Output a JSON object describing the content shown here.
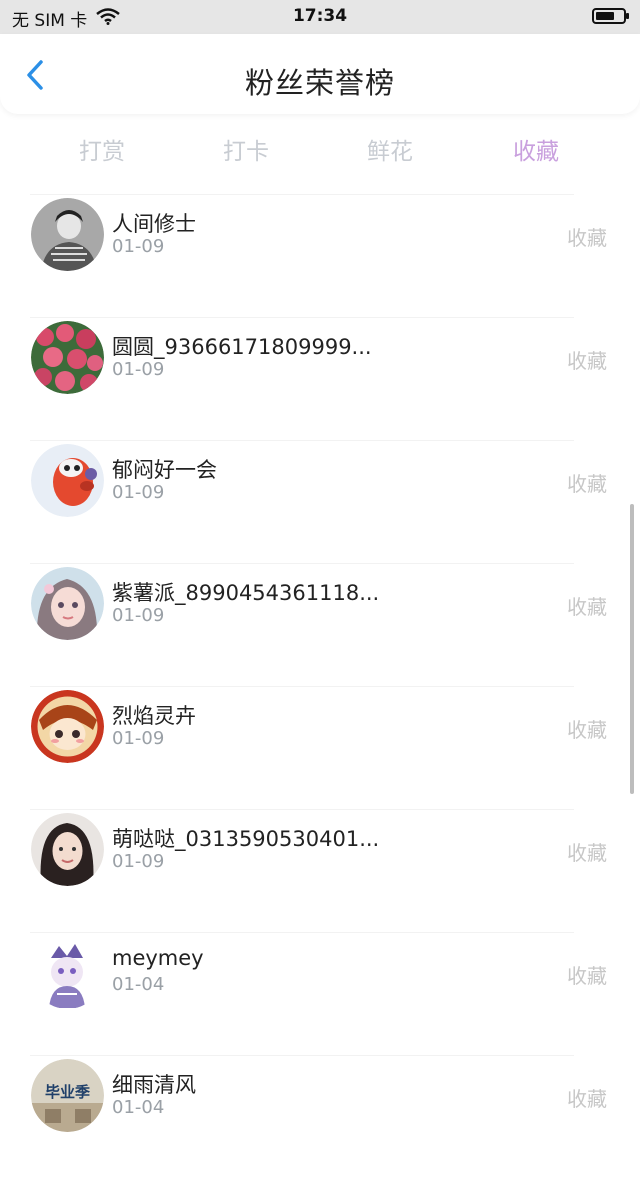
{
  "status": {
    "carrier": "无 SIM 卡",
    "time": "17:34"
  },
  "header": {
    "title": "粉丝荣誉榜"
  },
  "tabs": [
    {
      "label": "打赏"
    },
    {
      "label": "打卡"
    },
    {
      "label": "鲜花"
    },
    {
      "label": "收藏"
    }
  ],
  "active_tab_index": 3,
  "colors": {
    "accent_tab": "#c9a0de",
    "inactive_tab": "#c8ccd2",
    "back_arrow": "#2b8fe6"
  },
  "fans": [
    {
      "name": "人间修士",
      "date": "01-09",
      "action": "收藏",
      "avatar": "bw-portrait"
    },
    {
      "name": "圆圆_93666171809999...",
      "date": "01-09",
      "action": "收藏",
      "avatar": "pink-flowers"
    },
    {
      "name": "郁闷好一会",
      "date": "01-09",
      "action": "收藏",
      "avatar": "red-cartoon"
    },
    {
      "name": "紫薯派_8990454361118...",
      "date": "01-09",
      "action": "收藏",
      "avatar": "girl-illustration"
    },
    {
      "name": "烈焰灵卉",
      "date": "01-09",
      "action": "收藏",
      "avatar": "anime-girl"
    },
    {
      "name": "萌哒哒_0313590530401...",
      "date": "01-09",
      "action": "收藏",
      "avatar": "girl-photo"
    },
    {
      "name": "meymey",
      "date": "01-04",
      "action": "收藏",
      "avatar": "purple-character"
    },
    {
      "name": "细雨清风",
      "date": "01-04",
      "action": "收藏",
      "avatar": "graduation-photo"
    }
  ],
  "avatar_overlay_text": {
    "graduation": "毕业季"
  }
}
